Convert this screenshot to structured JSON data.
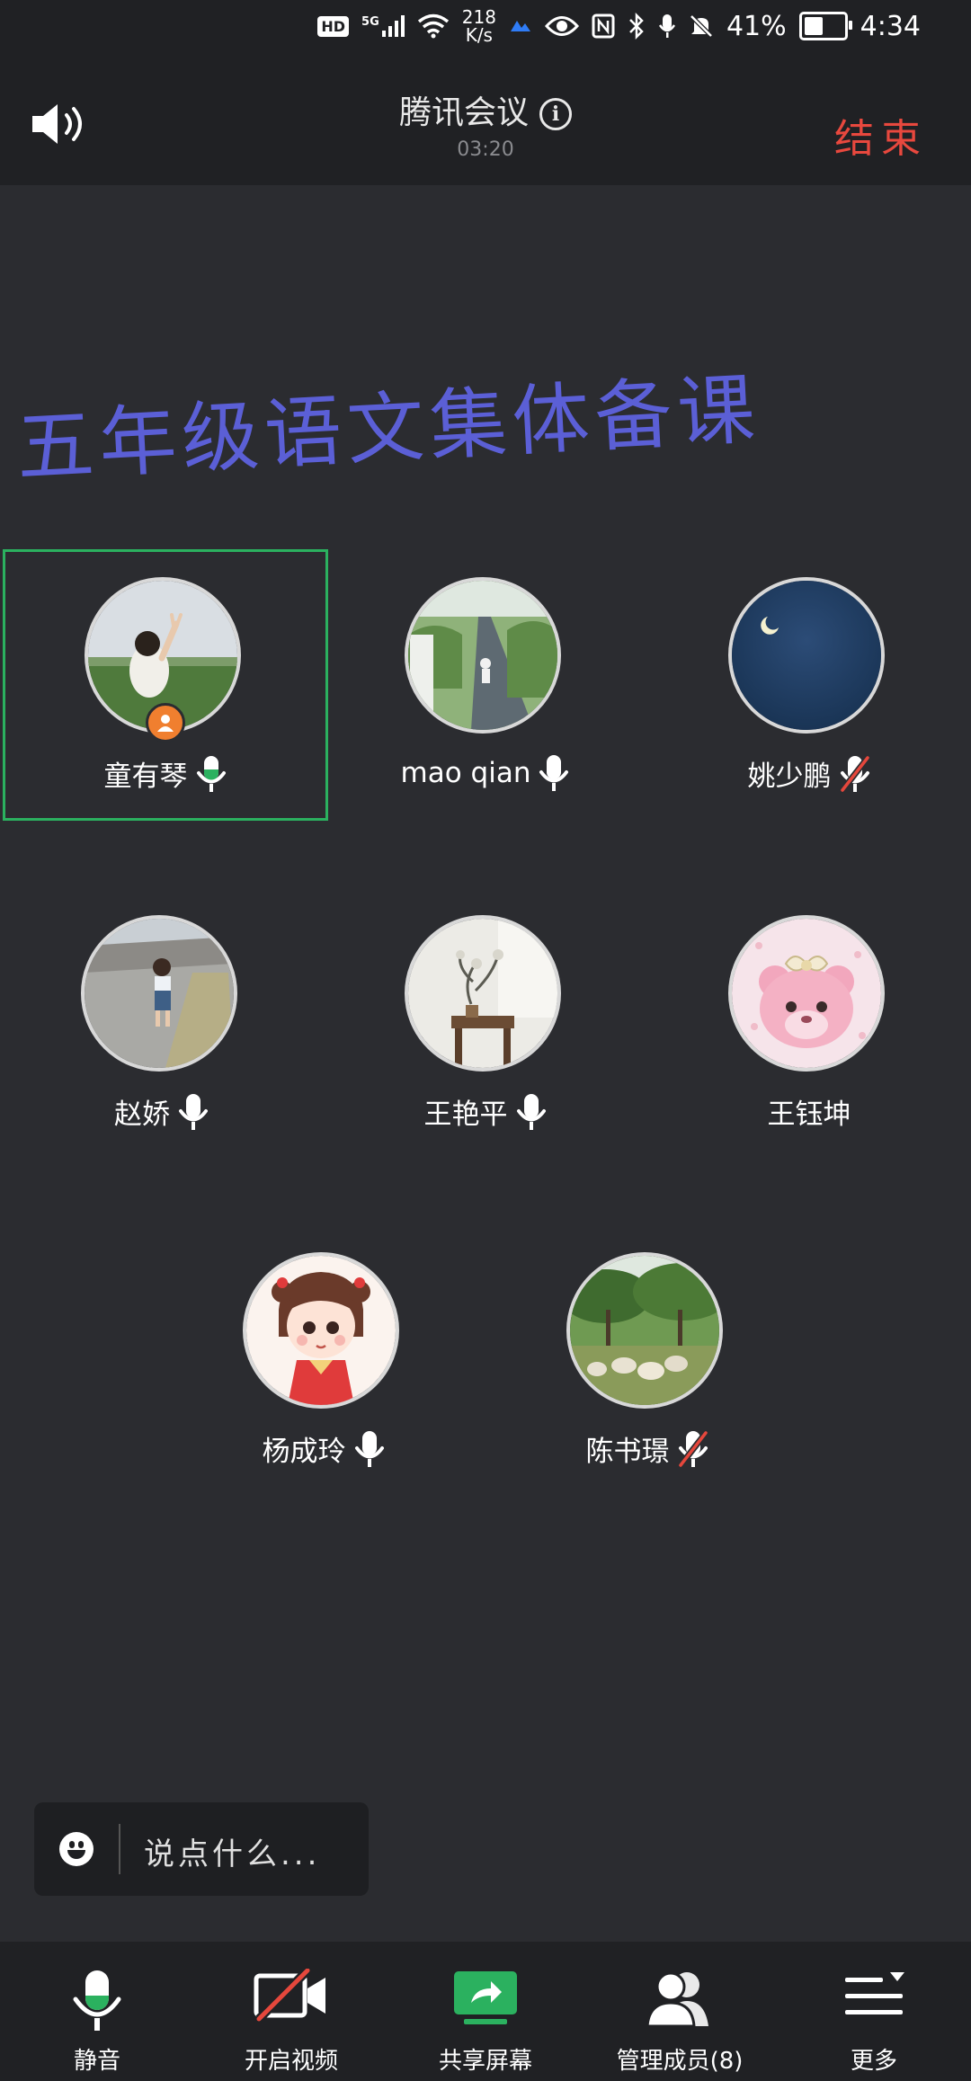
{
  "status_bar": {
    "hd": "HD",
    "network": "5G",
    "speed_value": "218",
    "speed_unit": "K/s",
    "battery": "41%",
    "time": "4:34"
  },
  "header": {
    "title": "腾讯会议",
    "timer": "03:20",
    "end_label": "结束"
  },
  "shared_content": {
    "handwriting": "五年级语文集体备课"
  },
  "participants": [
    {
      "name": "童有琴",
      "mic": "on-speaking",
      "host": true,
      "active": true,
      "avatar": "girl-in-field"
    },
    {
      "name": "mao qian",
      "mic": "on",
      "host": false,
      "active": false,
      "avatar": "road-with-trees"
    },
    {
      "name": "姚少鹏",
      "mic": "muted",
      "host": false,
      "active": false,
      "avatar": "night-sky-moon"
    },
    {
      "name": "赵娇",
      "mic": "on",
      "host": false,
      "active": false,
      "avatar": "child-on-street"
    },
    {
      "name": "王艳平",
      "mic": "on",
      "host": false,
      "active": false,
      "avatar": "room-with-plant"
    },
    {
      "name": "王钰坤",
      "mic": "none",
      "host": false,
      "active": false,
      "avatar": "pink-bear"
    },
    {
      "name": "杨成玲",
      "mic": "on",
      "host": false,
      "active": false,
      "avatar": "cartoon-girl"
    },
    {
      "name": "陈书璟",
      "mic": "muted",
      "host": false,
      "active": false,
      "avatar": "sheep-under-trees"
    }
  ],
  "chat": {
    "placeholder": "说点什么..."
  },
  "toolbar": {
    "mute_label": "静音",
    "video_label": "开启视频",
    "share_label": "共享屏幕",
    "members_label": "管理成员(8)",
    "more_label": "更多"
  },
  "colors": {
    "background": "#2b2c30",
    "bar": "#202124",
    "accent_green": "#2bb15f",
    "end_red": "#e8483e",
    "host_orange": "#f07f2f",
    "mute_red": "#e5473c",
    "handwriting_blue": "#5b5fd6"
  }
}
